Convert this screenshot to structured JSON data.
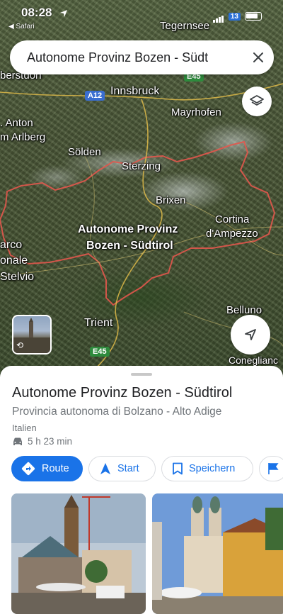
{
  "status_bar": {
    "time": "08:28",
    "back_label": "◀ Safari",
    "battery_badge": "13"
  },
  "search": {
    "query": "Autonome Provinz Bozen - Südt"
  },
  "map_labels": {
    "tegernsee": "Tegernsee",
    "oberstdorf": "berstdorf",
    "innsbruck": "Innsbruck",
    "mayrhofen": "Mayrhofen",
    "st_anton_1": ". Anton",
    "st_anton_2": "m Arlberg",
    "soelden": "Sölden",
    "sterzing": "Sterzing",
    "brixen": "Brixen",
    "cortina_1": "Cortina",
    "cortina_2": "d'Ampezzo",
    "province_1": "Autonome Provinz",
    "province_2": "Bozen - Südtirol",
    "parco": "arco",
    "nazionale": "onale",
    "stelvio": "Stelvio",
    "belluno": "Belluno",
    "trient": "Trient",
    "conegliano": "Coneglianc",
    "a12": "A12",
    "e45_top": "E45",
    "e45_bottom": "E45"
  },
  "place": {
    "title": "Autonome Provinz Bozen - Südtirol",
    "subtitle": "Provincia autonoma di Bolzano - Alto Adige",
    "country": "Italien",
    "drive_time": "5 h 23 min"
  },
  "actions": {
    "route": "Route",
    "start": "Start",
    "save": "Speichern"
  },
  "colors": {
    "accent": "#1a73e8",
    "border_line": "#e2574c"
  },
  "icons": [
    "navigation-arrow-icon",
    "close-icon",
    "layers-icon",
    "car-icon",
    "directions-icon",
    "start-arrow-icon",
    "bookmark-icon",
    "flag-icon",
    "rotate-icon"
  ]
}
